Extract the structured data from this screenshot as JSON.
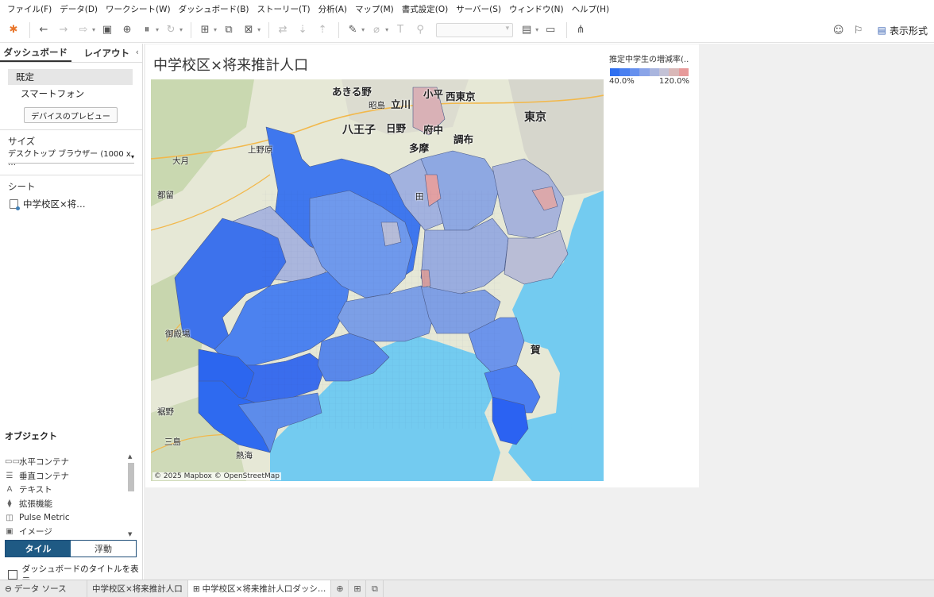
{
  "menu": [
    "ファイル(F)",
    "データ(D)",
    "ワークシート(W)",
    "ダッシュボード(B)",
    "ストーリー(T)",
    "分析(A)",
    "マップ(M)",
    "書式設定(O)",
    "サーバー(S)",
    "ウィンドウ(N)",
    "ヘルプ(H)"
  ],
  "toolbar": {
    "show_me_label": "表示形式"
  },
  "left_panel": {
    "tab_dashboard": "ダッシュボード",
    "tab_layout": "レイアウト",
    "device_default": "既定",
    "device_phone": "スマートフォン",
    "device_preview_button": "デバイスのプレビュー",
    "size_title": "サイズ",
    "size_value": "デスクトップ ブラウザー (1000 x …",
    "sheets_title": "シート",
    "sheet_item": "中学校区×将…",
    "objects_title": "オブジェクト",
    "objects": [
      {
        "icon": "horizontal-container-icon",
        "label": "水平コンテナ"
      },
      {
        "icon": "vertical-container-icon",
        "label": "垂直コンテナ"
      },
      {
        "icon": "text-icon",
        "label": "テキスト"
      },
      {
        "icon": "extension-icon",
        "label": "拡張機能"
      },
      {
        "icon": "pulse-metric-icon",
        "label": "Pulse Metric"
      },
      {
        "icon": "image-icon",
        "label": "イメージ"
      }
    ],
    "tile_label": "タイル",
    "float_label": "浮動",
    "show_title_label": "ダッシュボードのタイトルを表示"
  },
  "dashboard": {
    "title": "中学校区×将来推計人口",
    "legend": {
      "title": "推定中学生の増減率(..",
      "min_label": "40.0%",
      "max_label": "120.0%",
      "colors": [
        "#2f6ff0",
        "#4a80f0",
        "#6690ee",
        "#8aa4e8",
        "#a9b5de",
        "#c3c2d6",
        "#d9b8b8",
        "#e79a9a"
      ]
    },
    "map": {
      "place_labels": {
        "akiruno": "あきる野",
        "akishima": "昭島",
        "tachikawa": "立川",
        "kodaira": "小平",
        "nishitokyo": "西東京",
        "tokyo": "東京",
        "hachioji": "八王子",
        "hino": "日野",
        "fuchu": "府中",
        "tama": "多摩",
        "chofu": "調布",
        "uenohara": "上野原",
        "otsuki": "大月",
        "tsuru": "都留",
        "gotemba": "御殿場",
        "susono": "裾野",
        "mishima": "三島",
        "atami": "熱海",
        "ka": "賀",
        "ta": "田"
      },
      "attribution": "© 2025 Mapbox © OpenStreetMap"
    }
  },
  "bottom": {
    "data_source": "データ ソース",
    "sheet_tab": "中学校区×将来推計人口",
    "dashboard_tab": "中学校区×将来推計人口ダッシ…"
  }
}
